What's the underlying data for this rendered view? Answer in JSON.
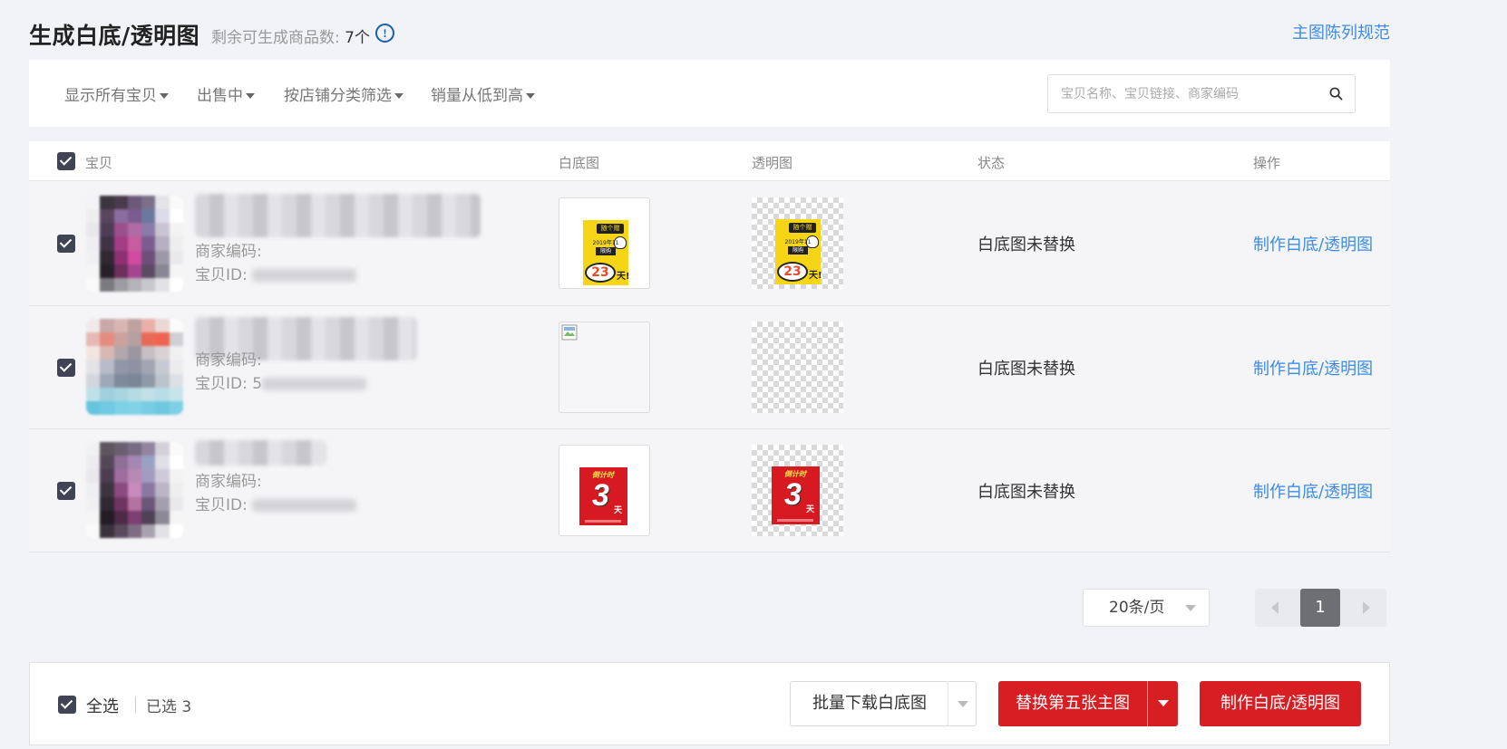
{
  "header": {
    "title": "生成白底/透明图",
    "quota_label": "剩余可生成商品数:",
    "quota_value": "7个",
    "info_icon": "info-circle-icon",
    "spec_link": "主图陈列规范"
  },
  "filters": {
    "items": [
      {
        "label": "显示所有宝贝"
      },
      {
        "label": "出售中"
      },
      {
        "label": "按店铺分类筛选"
      },
      {
        "label": "销量从低到高"
      }
    ],
    "search_placeholder": "宝贝名称、宝贝链接、商家编码",
    "search_icon": "search-icon"
  },
  "table": {
    "columns": [
      "宝贝",
      "白底图",
      "透明图",
      "状态",
      "操作"
    ],
    "rows": [
      {
        "merchant_code_label": "商家编码:",
        "item_id_label": "宝贝ID:",
        "white_image": "yellow-poster",
        "transparent_image": "yellow-poster",
        "poster_text": {
          "tag": "随个赠",
          "line": "2019年11",
          "badge": "限购",
          "number": "23",
          "unit": "天!"
        },
        "status": "白底图未替换",
        "action": "制作白底/透明图"
      },
      {
        "merchant_code_label": "商家编码:",
        "item_id_label": "宝贝ID:",
        "item_id_partial": "5",
        "white_image": "broken-image",
        "transparent_image": "empty",
        "status": "白底图未替换",
        "action": "制作白底/透明图"
      },
      {
        "merchant_code_label": "商家编码:",
        "item_id_label": "宝贝ID:",
        "white_image": "red-poster",
        "transparent_image": "red-poster",
        "poster_text": {
          "header": "倒计时",
          "number": "3",
          "unit": "天"
        },
        "status": "白底图未替换",
        "action": "制作白底/透明图"
      }
    ]
  },
  "pagination": {
    "page_size": "20条/页",
    "current_page": "1"
  },
  "footer": {
    "select_all": "全选",
    "selected": "已选 3",
    "download_btn": "批量下载白底图",
    "replace_btn": "替换第五张主图",
    "make_btn": "制作白底/透明图"
  },
  "colors": {
    "accent_red": "#d71e23",
    "link_blue": "#3c8ce6",
    "checkbox_dark": "#3f4554"
  }
}
